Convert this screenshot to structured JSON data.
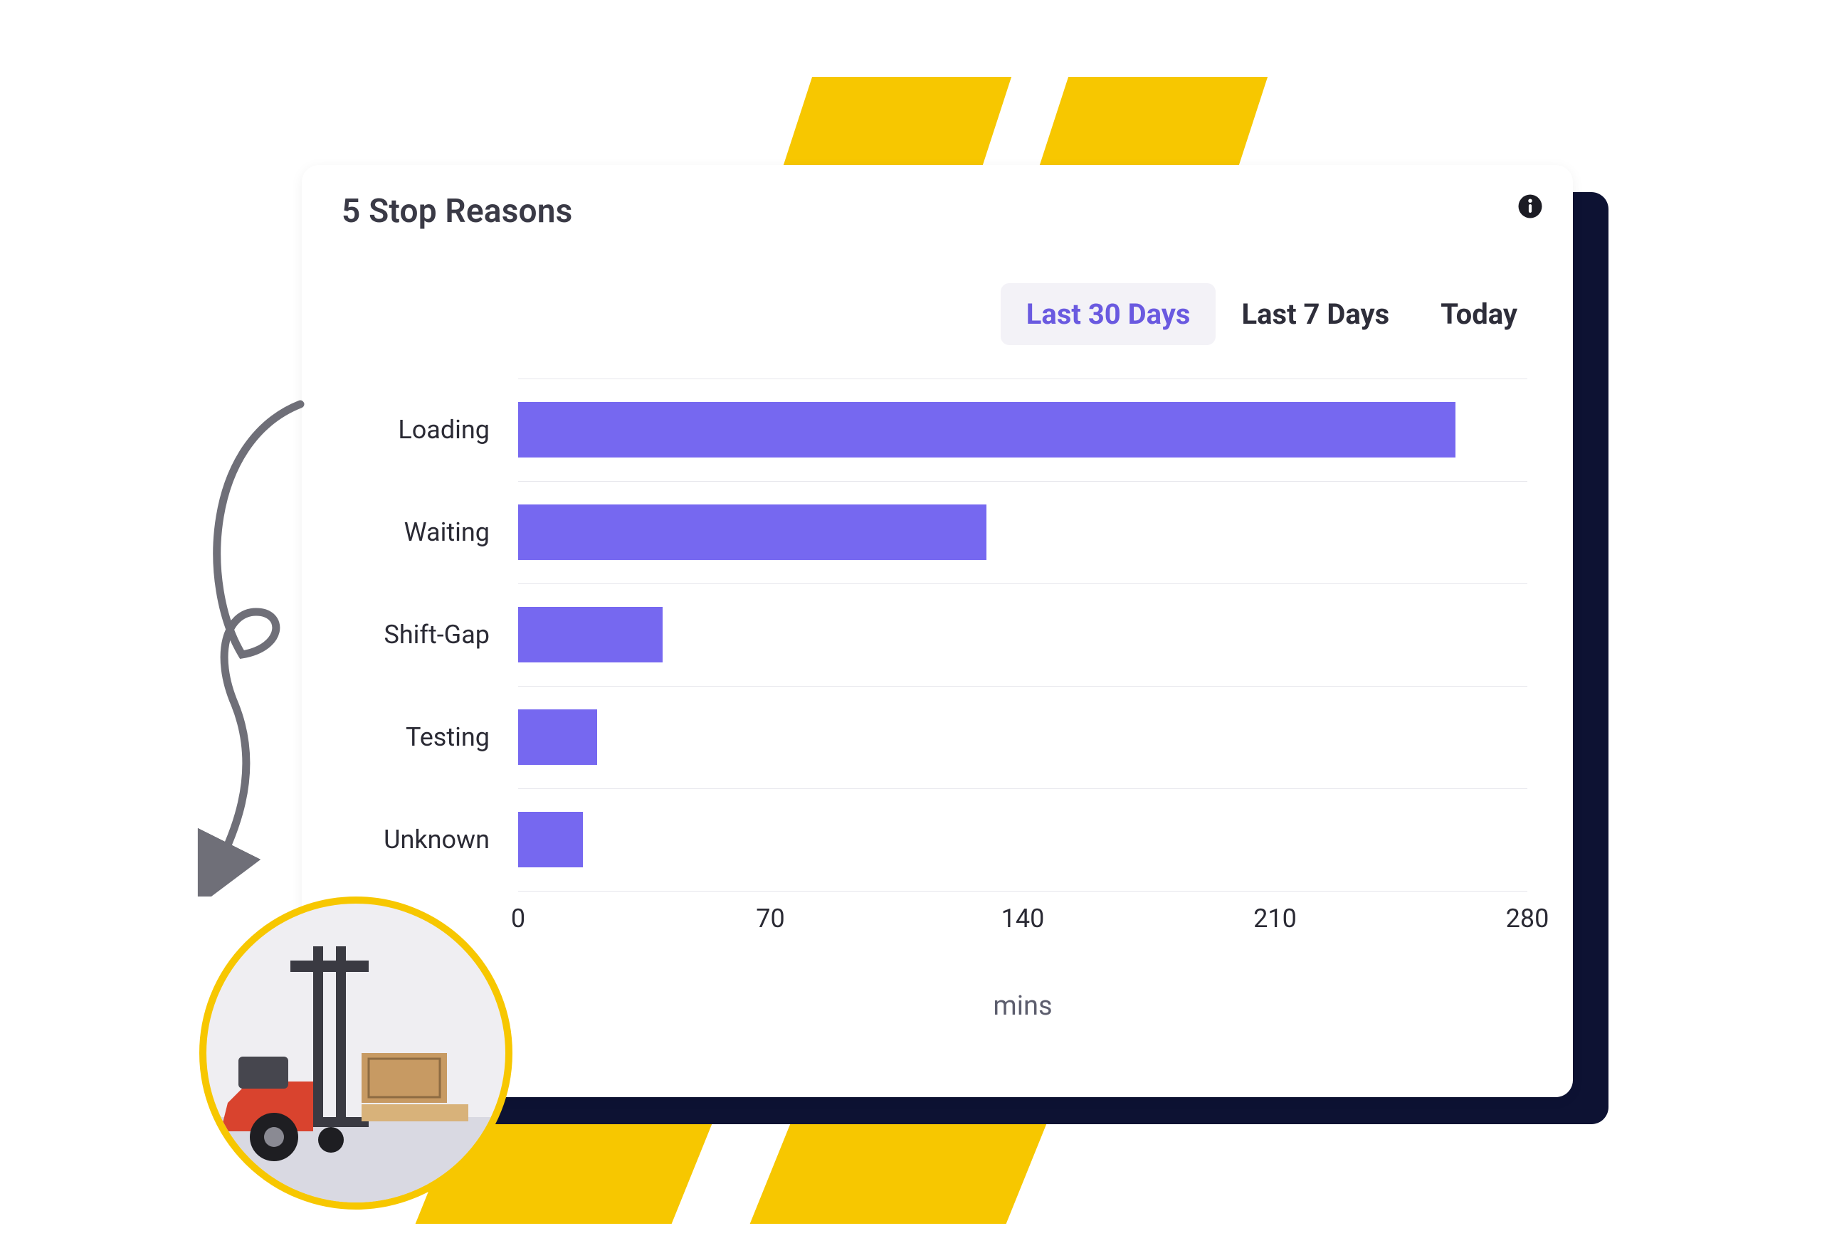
{
  "card": {
    "title": "5 Stop Reasons",
    "info_tooltip": "Info"
  },
  "tabs": {
    "items": [
      {
        "label": "Last 30 Days",
        "active": true
      },
      {
        "label": "Last 7 Days",
        "active": false
      },
      {
        "label": "Today",
        "active": false
      }
    ]
  },
  "chart_data": {
    "type": "bar",
    "orientation": "horizontal",
    "categories": [
      "Loading",
      "Waiting",
      "Shift-Gap",
      "Testing",
      "Unknown"
    ],
    "values": [
      260,
      130,
      40,
      22,
      18
    ],
    "xlabel": "mins",
    "ylabel": "",
    "xlim": [
      0,
      280
    ],
    "x_ticks": [
      0,
      70,
      140,
      210,
      280
    ],
    "title": "5 Stop Reasons",
    "series_color": "#7668f0"
  },
  "decor": {
    "badge_alt": "forklift loading boxes",
    "accent_color": "#f7c700"
  }
}
